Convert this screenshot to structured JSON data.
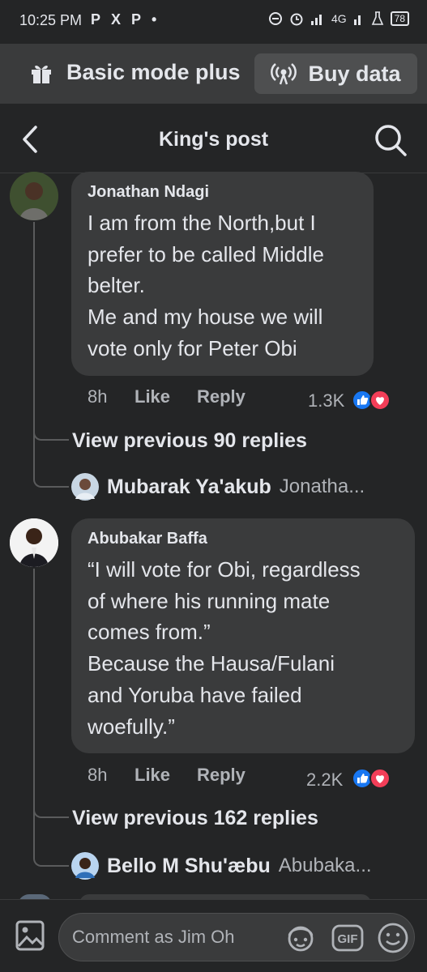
{
  "status_bar": {
    "time": "10:25 PM",
    "apps": [
      "P",
      "X",
      "P",
      "•"
    ],
    "network": "4G",
    "battery": "78"
  },
  "mode_bar": {
    "label": "Basic mode plus",
    "buy_label": "Buy data",
    "gift_icon": "gift-icon",
    "signal_icon": "broadcast-icon"
  },
  "header": {
    "title": "King's post",
    "back_icon": "chevron-left-icon",
    "search_icon": "search-icon"
  },
  "comments": [
    {
      "author": "Jonathan Ndagi",
      "text": "I am from the North,but I\nprefer to be called Middle\nbelter.\nMe and my house we will\nvote only for Peter Obi",
      "time": "8h",
      "like_label": "Like",
      "reply_label": "Reply",
      "reactions": "1.3K",
      "view_previous": "View previous 90 replies",
      "reply_preview": {
        "name": "Mubarak Ya'akub",
        "snippet": "Jonatha..."
      }
    },
    {
      "author": "Abubakar Baffa",
      "text": "“I will vote for Obi, regardless\nof where his running mate\ncomes from.”\nBecause the Hausa/Fulani\nand Yoruba have failed\nwoefully.”",
      "time": "8h",
      "like_label": "Like",
      "reply_label": "Reply",
      "reactions": "2.2K",
      "view_previous": "View previous 162 replies",
      "reply_preview": {
        "name": "Bello M Shu'æbu",
        "snippet": "Abubaka..."
      }
    }
  ],
  "composer": {
    "placeholder": "Comment as Jim Oh",
    "gif_label": "GIF"
  },
  "colors": {
    "background": "#242526",
    "bubble": "#3a3b3c",
    "like_blue": "#1877f2",
    "love_red": "#f33e58"
  }
}
